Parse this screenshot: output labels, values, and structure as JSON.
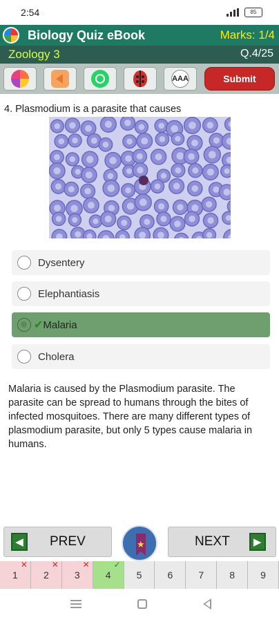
{
  "status_bar": {
    "time": "2:54",
    "battery": "85"
  },
  "header": {
    "title": "Biology Quiz eBook",
    "marks": "Marks: 1/4",
    "subject": "Zoology 3",
    "question_counter": "Q.4/25"
  },
  "toolbar": {
    "icons": [
      "apps-icon",
      "sound-icon",
      "whatsapp-icon",
      "bug-report-icon",
      "font-size-icon"
    ],
    "font_label": "AAA",
    "submit_label": "Submit"
  },
  "question": {
    "text": "4. Plasmodium is a parasite that causes",
    "options": [
      {
        "label": "Dysentery",
        "state": "none"
      },
      {
        "label": "Elephantiasis",
        "state": "none"
      },
      {
        "label": "Malaria",
        "state": "correct"
      },
      {
        "label": "Cholera",
        "state": "none"
      }
    ],
    "check_mark": "✔"
  },
  "explanation": "Malaria is caused by the Plasmodium parasite. The parasite can be spread to humans through the bites of infected mosquitoes. There are many different types of plasmodium parasite, but only 5 types cause malaria in humans.",
  "navigation": {
    "prev_label": "PREV",
    "next_label": "NEXT",
    "prev_glyph": "◀",
    "next_glyph": "▶"
  },
  "pages": [
    {
      "num": "1",
      "state": "wrong",
      "mark": "✕"
    },
    {
      "num": "2",
      "state": "wrong",
      "mark": "✕"
    },
    {
      "num": "3",
      "state": "wrong",
      "mark": "✕"
    },
    {
      "num": "4",
      "state": "right",
      "mark": "✓"
    },
    {
      "num": "5",
      "state": "none",
      "mark": ""
    },
    {
      "num": "6",
      "state": "none",
      "mark": ""
    },
    {
      "num": "7",
      "state": "none",
      "mark": ""
    },
    {
      "num": "8",
      "state": "none",
      "mark": ""
    },
    {
      "num": "9",
      "state": "none",
      "mark": ""
    }
  ],
  "colors": {
    "header": "#1f7a64",
    "subheader": "#2d5d50",
    "marks": "#ffea00",
    "subject": "#d8ff3c",
    "correct_option": "#6f9e6f",
    "submit": "#c62828"
  }
}
